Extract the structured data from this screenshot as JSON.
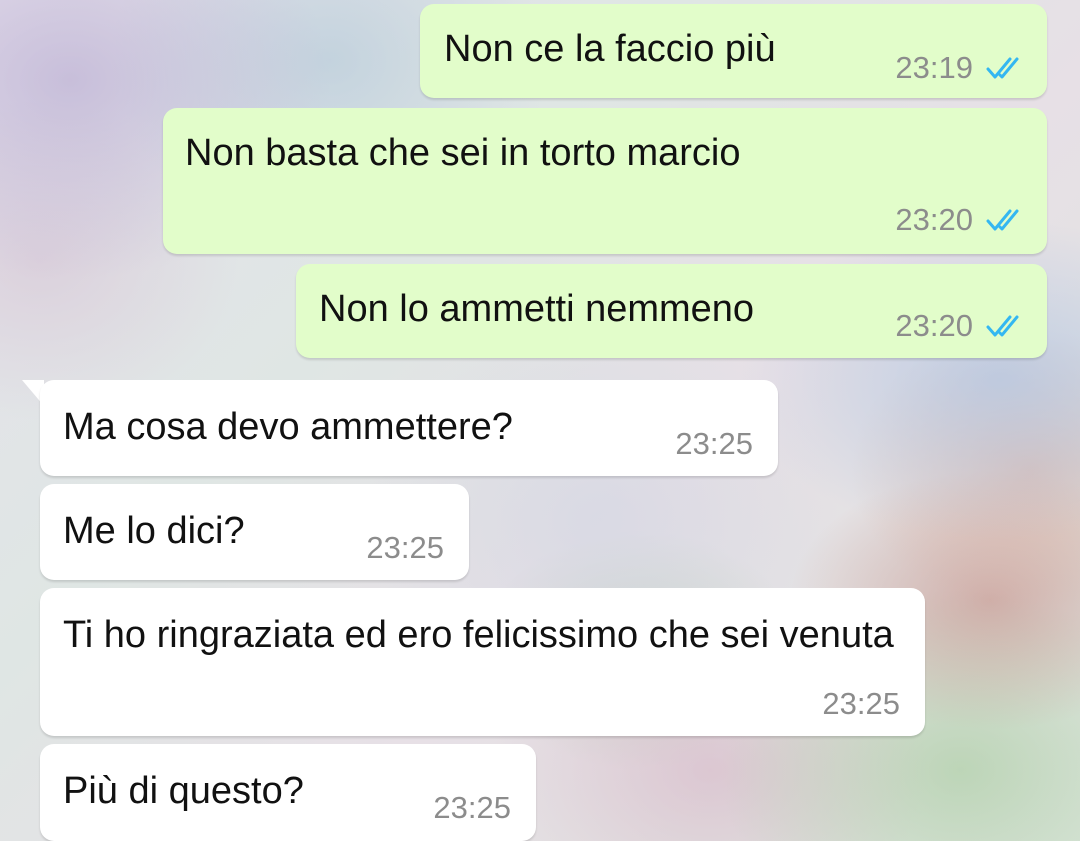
{
  "conversation": {
    "messages": [
      {
        "direction": "outgoing",
        "text": "Non ce la faccio più",
        "time": "23:19",
        "status_icon": "double-check-read-icon"
      },
      {
        "direction": "outgoing",
        "text": "Non basta che sei in torto marcio",
        "time": "23:20",
        "status_icon": "double-check-read-icon"
      },
      {
        "direction": "outgoing",
        "text": "Non lo ammetti nemmeno",
        "time": "23:20",
        "status_icon": "double-check-read-icon"
      },
      {
        "direction": "incoming",
        "text": "Ma cosa devo ammettere?",
        "time": "23:25"
      },
      {
        "direction": "incoming",
        "text": "Me lo dici?",
        "time": "23:25"
      },
      {
        "direction": "incoming",
        "text": "Ti ho ringraziata ed ero felicissimo che sei venuta",
        "time": "23:25"
      },
      {
        "direction": "incoming",
        "text": "Più di questo?",
        "time": "23:25"
      }
    ]
  },
  "colors": {
    "outgoing_bubble": "#e2fdca",
    "incoming_bubble": "#ffffff",
    "read_ticks": "#34b7f1",
    "timestamp": "#8c8c8c"
  }
}
